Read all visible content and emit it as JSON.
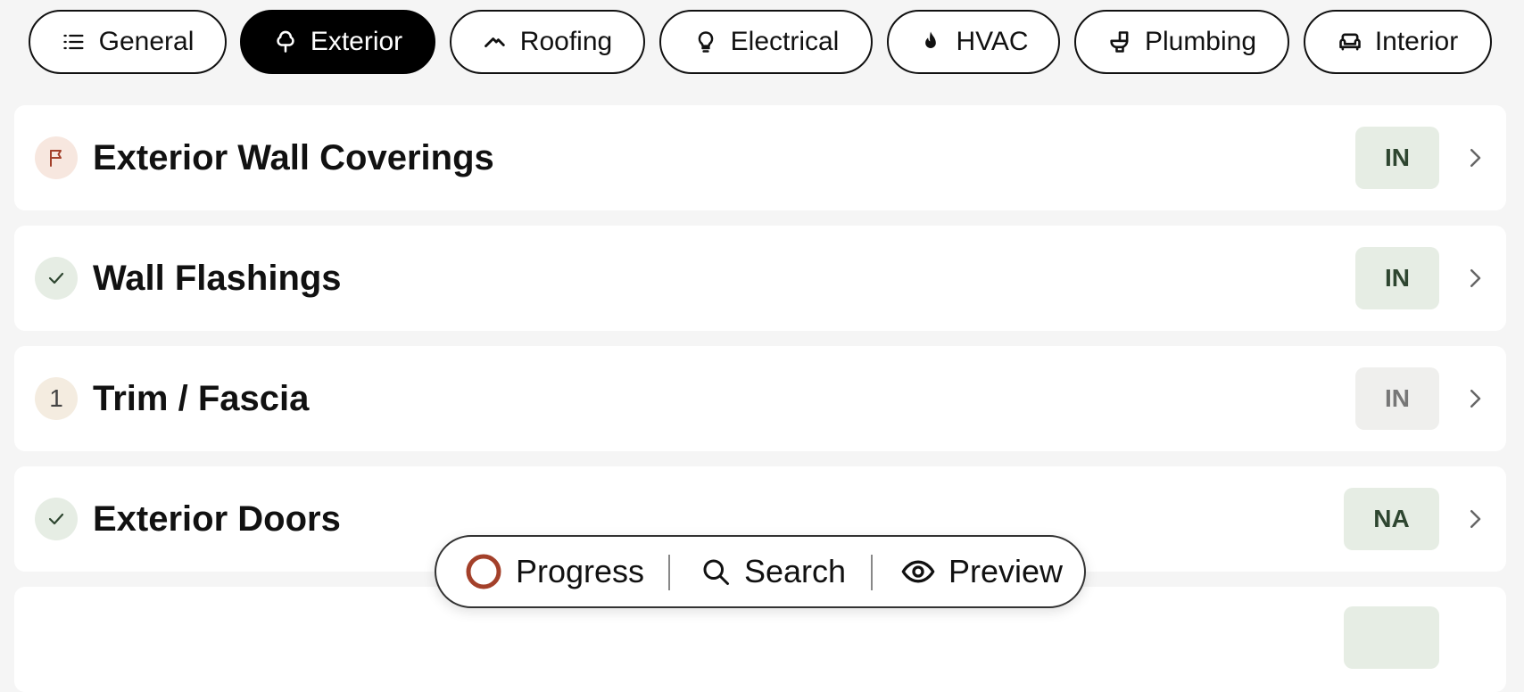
{
  "tabs": [
    {
      "label": "General",
      "icon": "list-icon",
      "active": false
    },
    {
      "label": "Exterior",
      "icon": "tree-icon",
      "active": true
    },
    {
      "label": "Roofing",
      "icon": "roof-icon",
      "active": false
    },
    {
      "label": "Electrical",
      "icon": "lightbulb-icon",
      "active": false
    },
    {
      "label": "HVAC",
      "icon": "flame-icon",
      "active": false
    },
    {
      "label": "Plumbing",
      "icon": "toilet-icon",
      "active": false
    },
    {
      "label": "Interior",
      "icon": "sofa-icon",
      "active": false
    }
  ],
  "rows": [
    {
      "title": "Exterior Wall Coverings",
      "status": "flag",
      "badge": "IN"
    },
    {
      "title": "Wall Flashings",
      "status": "check",
      "badge": "IN"
    },
    {
      "title": "Trim / Fascia",
      "status": "count",
      "count": "1",
      "badge": "IN"
    },
    {
      "title": "Exterior Doors",
      "status": "check",
      "badge": "NA"
    },
    {
      "title": "",
      "status": "",
      "badge": ""
    }
  ],
  "toolbar": {
    "progress_label": "Progress",
    "search_label": "Search",
    "preview_label": "Preview"
  },
  "colors": {
    "accent": "#a3402a",
    "badge_green_bg": "#e6ede4",
    "badge_green_text": "#2e4630",
    "badge_grey_bg": "#efefed",
    "badge_grey_text": "#777777",
    "flag_bg": "#f7e7df",
    "check_bg": "#e6ede4",
    "count_bg": "#f4ece0"
  }
}
